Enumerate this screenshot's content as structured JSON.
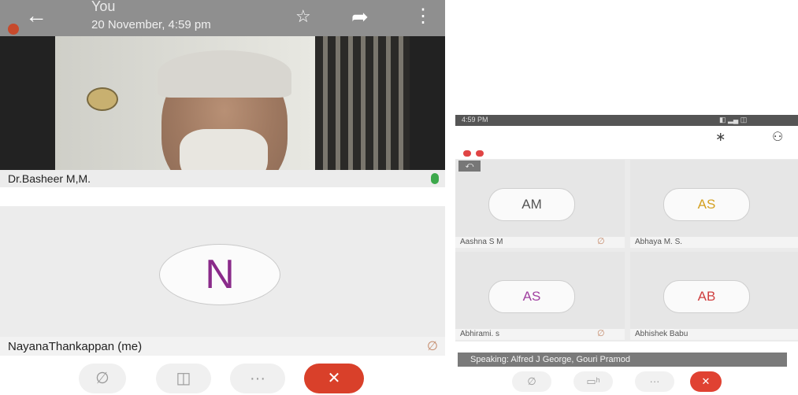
{
  "left_call": {
    "header": {
      "back_icon": "←",
      "title": "You",
      "subtitle": "20 November, 4:59 pm",
      "star_icon": "☆",
      "forward_icon": "➦",
      "more_icon": "⋮"
    },
    "video_participant": {
      "name": "Dr.Basheer M,M."
    },
    "self_participant": {
      "initial": "N",
      "name": "NayanaThankappan (me)",
      "mute_icon": "∅"
    },
    "controls": [
      {
        "name": "mic",
        "glyph": "∅"
      },
      {
        "name": "camera",
        "glyph": "◫"
      },
      {
        "name": "more",
        "glyph": "···"
      },
      {
        "name": "hangup",
        "glyph": "✕"
      }
    ]
  },
  "right_call": {
    "status_left": "4:59 PM",
    "status_right": "◧ ▂▄ ◫",
    "bluetooth_icon": "∗",
    "participants_icon": "⚇",
    "share_icon": "⤺",
    "participants": [
      {
        "initials": "AM",
        "name": "Aashna S M",
        "color": "#555555",
        "muted": true
      },
      {
        "initials": "AS",
        "name": "Abhaya M. S.",
        "color": "#d4a020",
        "muted": false
      },
      {
        "initials": "AS",
        "name": "Abhirami. s",
        "color": "#a040a0",
        "muted": true
      },
      {
        "initials": "AB",
        "name": "Abhishek Babu",
        "color": "#d04040",
        "muted": false
      }
    ],
    "speaking": "Speaking: Alfred J George, Gouri Pramod",
    "controls": [
      {
        "name": "mic",
        "glyph": "∅"
      },
      {
        "name": "camera",
        "glyph": "▭ʰ"
      },
      {
        "name": "more",
        "glyph": "···"
      },
      {
        "name": "hangup",
        "glyph": "✕"
      }
    ],
    "colors": {
      "hangup": "#e04232",
      "speaking_bar": "#7a7a7a"
    }
  }
}
